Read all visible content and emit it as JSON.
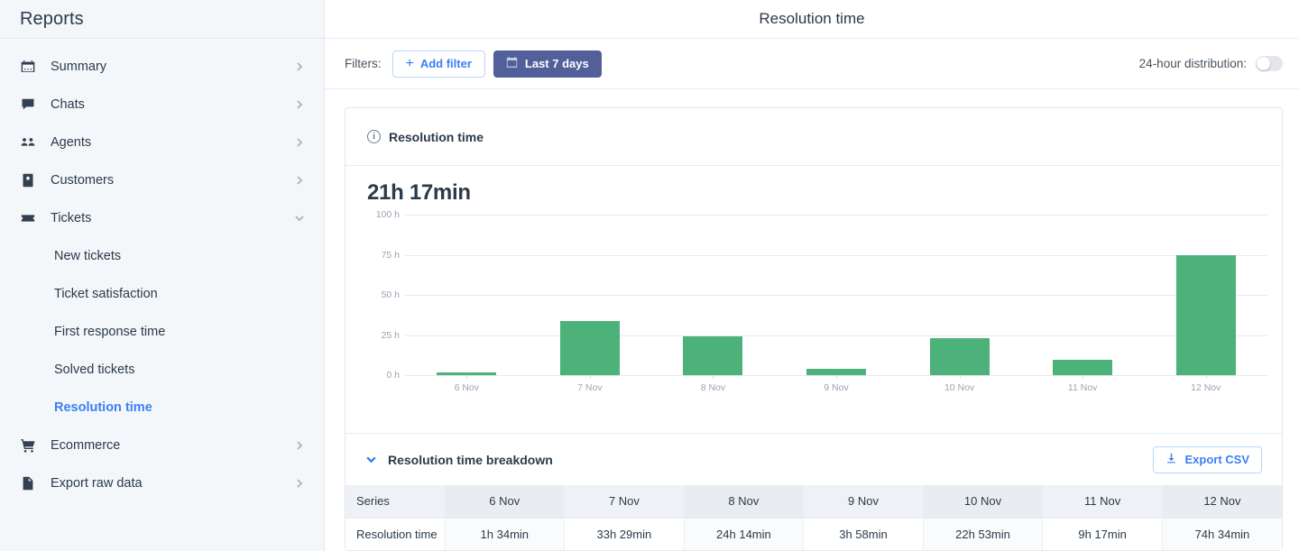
{
  "sidebar": {
    "title": "Reports",
    "items": [
      {
        "label": "Summary",
        "icon": "calendar-icon",
        "expandable": true
      },
      {
        "label": "Chats",
        "icon": "chat-icon",
        "expandable": true
      },
      {
        "label": "Agents",
        "icon": "people-icon",
        "expandable": true
      },
      {
        "label": "Customers",
        "icon": "contact-card-icon",
        "expandable": true
      },
      {
        "label": "Tickets",
        "icon": "ticket-icon",
        "expandable": true,
        "expanded": true
      }
    ],
    "tickets_children": [
      {
        "label": "New tickets",
        "active": false
      },
      {
        "label": "Ticket satisfaction",
        "active": false
      },
      {
        "label": "First response time",
        "active": false
      },
      {
        "label": "Solved tickets",
        "active": false
      },
      {
        "label": "Resolution time",
        "active": true
      }
    ],
    "items_bottom": [
      {
        "label": "Ecommerce",
        "icon": "cart-icon",
        "expandable": true
      },
      {
        "label": "Export raw data",
        "icon": "file-export-icon",
        "expandable": true
      }
    ]
  },
  "header": {
    "title": "Resolution time"
  },
  "filterbar": {
    "filters_label": "Filters:",
    "add_filter_label": "Add filter",
    "date_range_label": "Last 7 days",
    "distribution_label": "24-hour distribution:",
    "distribution_on": false
  },
  "card": {
    "head_title": "Resolution time",
    "metric_value": "21h 17min"
  },
  "breakdown": {
    "title": "Resolution time breakdown",
    "export_label": "Export CSV",
    "expanded": true,
    "columns": [
      "Series",
      "6 Nov",
      "7 Nov",
      "8 Nov",
      "9 Nov",
      "10 Nov",
      "11 Nov",
      "12 Nov"
    ],
    "rows": [
      [
        "Resolution time",
        "1h 34min",
        "33h 29min",
        "24h 14min",
        "3h 58min",
        "22h 53min",
        "9h 17min",
        "74h 34min"
      ]
    ]
  },
  "colors": {
    "bar_green": "#4cb279",
    "accent_blue": "#3b7ff5",
    "date_button": "#515f9a",
    "sidebar_bg": "#f4f7fa"
  },
  "chart_data": {
    "type": "bar",
    "title": "Resolution time",
    "categories": [
      "6 Nov",
      "7 Nov",
      "8 Nov",
      "9 Nov",
      "10 Nov",
      "11 Nov",
      "12 Nov"
    ],
    "values": [
      1.57,
      33.48,
      24.23,
      3.97,
      22.88,
      9.28,
      74.57
    ],
    "value_labels": [
      "1h 34min",
      "33h 29min",
      "24h 14min",
      "3h 58min",
      "22h 53min",
      "9h 17min",
      "74h 34min"
    ],
    "xlabel": "",
    "ylabel": "",
    "ylim": [
      0,
      100
    ],
    "yticks": [
      0,
      25,
      50,
      75,
      100
    ],
    "ytick_labels": [
      "0 h",
      "25 h",
      "50 h",
      "75 h",
      "100 h"
    ],
    "grid": true,
    "legend": false,
    "series_name": "Resolution time",
    "color": "#4cb279"
  }
}
